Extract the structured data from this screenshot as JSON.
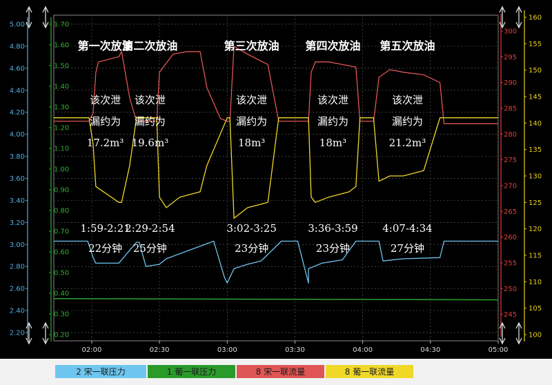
{
  "chart_data": {
    "type": "line",
    "x_ticks": [
      "02:00",
      "02:30",
      "03:00",
      "03:30",
      "04:00",
      "04:30",
      "05:00"
    ],
    "axes": {
      "a1": {
        "color": "#4fb0e0",
        "ylim": [
          2.2,
          5.0
        ],
        "ticks": [
          "2.20",
          "2.40",
          "2.60",
          "2.80",
          "3.00",
          "3.20",
          "3.40",
          "3.60",
          "3.80",
          "4.00",
          "4.20",
          "4.40",
          "4.60",
          "4.80",
          "5.00"
        ]
      },
      "a2": {
        "color": "#30b030",
        "ylim": [
          0.2,
          1.7
        ],
        "ticks": [
          "0.20",
          "0.30",
          "0.40",
          "0.50",
          "0.60",
          "0.70",
          "0.80",
          "0.90",
          "1.00",
          "1.10",
          "1.20",
          "1.30",
          "1.40",
          "1.50",
          "1.60",
          "1.70"
        ]
      },
      "a3": {
        "color": "#e04040",
        "ylim": [
          242,
          302
        ],
        "ticks": [
          "245",
          "250",
          "255",
          "260",
          "265",
          "270",
          "275",
          "280",
          "285",
          "290",
          "295",
          "300"
        ]
      },
      "a4": {
        "color": "#e8d020",
        "ylim": [
          100,
          160
        ],
        "ticks": [
          "100",
          "105",
          "110",
          "115",
          "120",
          "125",
          "130",
          "135",
          "140",
          "145",
          "150",
          "155",
          "160"
        ]
      }
    },
    "series": [
      {
        "name": "宋一联压力",
        "legend_num": "2",
        "axis": "a1",
        "color": "#6ec6ef",
        "x": [
          1.72,
          1.97,
          1.99,
          2.01,
          2.03,
          2.2,
          2.33,
          2.35,
          2.4,
          2.5,
          2.55,
          2.9,
          2.98,
          3.0,
          3.05,
          3.15,
          3.25,
          3.4,
          3.52,
          3.6,
          3.6,
          3.7,
          3.85,
          3.95,
          3.98,
          4.0,
          4.12,
          4.15,
          4.3,
          4.57,
          4.6,
          5.0
        ],
        "y": [
          3.03,
          3.03,
          2.96,
          2.88,
          2.83,
          2.83,
          3.02,
          3.02,
          2.8,
          2.82,
          2.87,
          3.03,
          2.7,
          2.65,
          2.78,
          2.82,
          2.85,
          3.03,
          3.03,
          2.65,
          2.78,
          2.83,
          2.86,
          3.03,
          3.03,
          3.03,
          3.03,
          2.85,
          2.87,
          2.88,
          3.03,
          3.03
        ]
      },
      {
        "name": "葡一联压力",
        "legend_num": "1",
        "axis": "a2",
        "color": "#2a9a2a",
        "x": [
          1.72,
          5.0
        ],
        "y": [
          0.374,
          0.368
        ]
      },
      {
        "name": "宋一联流量",
        "legend_num": "8",
        "axis": "a3",
        "color": "#e05555",
        "x": [
          1.72,
          1.98,
          2.01,
          2.03,
          2.05,
          2.2,
          2.22,
          2.28,
          2.33,
          2.48,
          2.5,
          2.6,
          2.7,
          2.8,
          2.85,
          2.95,
          3.0,
          3.02,
          3.05,
          3.15,
          3.3,
          3.38,
          3.6,
          3.62,
          3.65,
          3.75,
          3.85,
          3.95,
          3.98,
          4.08,
          4.12,
          4.2,
          4.3,
          4.45,
          4.57,
          4.6,
          5.0
        ],
        "y": [
          282.5,
          282.5,
          284,
          292,
          294,
          295,
          296,
          287,
          282.5,
          282.5,
          292,
          295.5,
          296,
          296,
          289,
          283,
          282.5,
          282.5,
          297,
          295.5,
          293.5,
          282.5,
          282.5,
          292,
          294,
          294,
          293.5,
          293,
          282.5,
          282.5,
          291,
          292.5,
          292,
          291.5,
          290,
          282,
          282
        ]
      },
      {
        "name": "葡一联流量",
        "legend_num": "8",
        "axis": "a4",
        "color": "#f0d828",
        "x": [
          1.72,
          1.98,
          2.01,
          2.03,
          2.2,
          2.22,
          2.28,
          2.33,
          2.48,
          2.5,
          2.55,
          2.65,
          2.8,
          2.85,
          2.95,
          3.0,
          3.02,
          3.05,
          3.15,
          3.3,
          3.38,
          3.6,
          3.62,
          3.65,
          3.75,
          3.9,
          3.95,
          3.98,
          4.08,
          4.12,
          4.2,
          4.3,
          4.45,
          4.57,
          4.6,
          5.0
        ],
        "y": [
          141,
          141,
          136,
          128,
          125,
          125,
          132,
          141,
          141,
          126,
          124,
          126,
          127,
          132,
          138,
          141,
          141,
          122,
          124,
          125,
          141,
          141,
          126,
          125,
          126,
          127,
          128,
          141,
          141,
          129,
          130,
          130,
          131,
          141,
          141,
          141
        ]
      }
    ],
    "annotations": [
      {
        "x": 2.1,
        "lines": [
          "第一次放油"
        ],
        "style": "title"
      },
      {
        "x": 2.1,
        "lines": [
          "该次泄",
          "漏约为",
          "17.2m³"
        ]
      },
      {
        "x": 2.1,
        "lines": [
          "1:59-2:21",
          "22分钟"
        ]
      },
      {
        "x": 2.43,
        "lines": [
          "第二次放油"
        ],
        "style": "title"
      },
      {
        "x": 2.43,
        "lines": [
          "该次泄",
          "漏约为",
          "19.6m³"
        ]
      },
      {
        "x": 2.43,
        "lines": [
          "2:29-2:54",
          "25分钟"
        ]
      },
      {
        "x": 3.18,
        "lines": [
          "第三次放油"
        ],
        "style": "title"
      },
      {
        "x": 3.18,
        "lines": [
          "该次泄",
          "漏约为",
          "18m³"
        ]
      },
      {
        "x": 3.18,
        "lines": [
          "3:02-3:25",
          "23分钟"
        ]
      },
      {
        "x": 3.78,
        "lines": [
          "第四次放油"
        ],
        "style": "title"
      },
      {
        "x": 3.78,
        "lines": [
          "该次泄",
          "漏约为",
          "18m³"
        ]
      },
      {
        "x": 3.78,
        "lines": [
          "3:36-3:59",
          "23分钟"
        ]
      },
      {
        "x": 4.33,
        "lines": [
          "第五次放油"
        ],
        "style": "title"
      },
      {
        "x": 4.33,
        "lines": [
          "该次泄",
          "漏约为",
          "21.2m³"
        ]
      },
      {
        "x": 4.33,
        "lines": [
          "4:07-4:34",
          "27分钟"
        ]
      }
    ],
    "grid": true,
    "background": "#000000"
  }
}
